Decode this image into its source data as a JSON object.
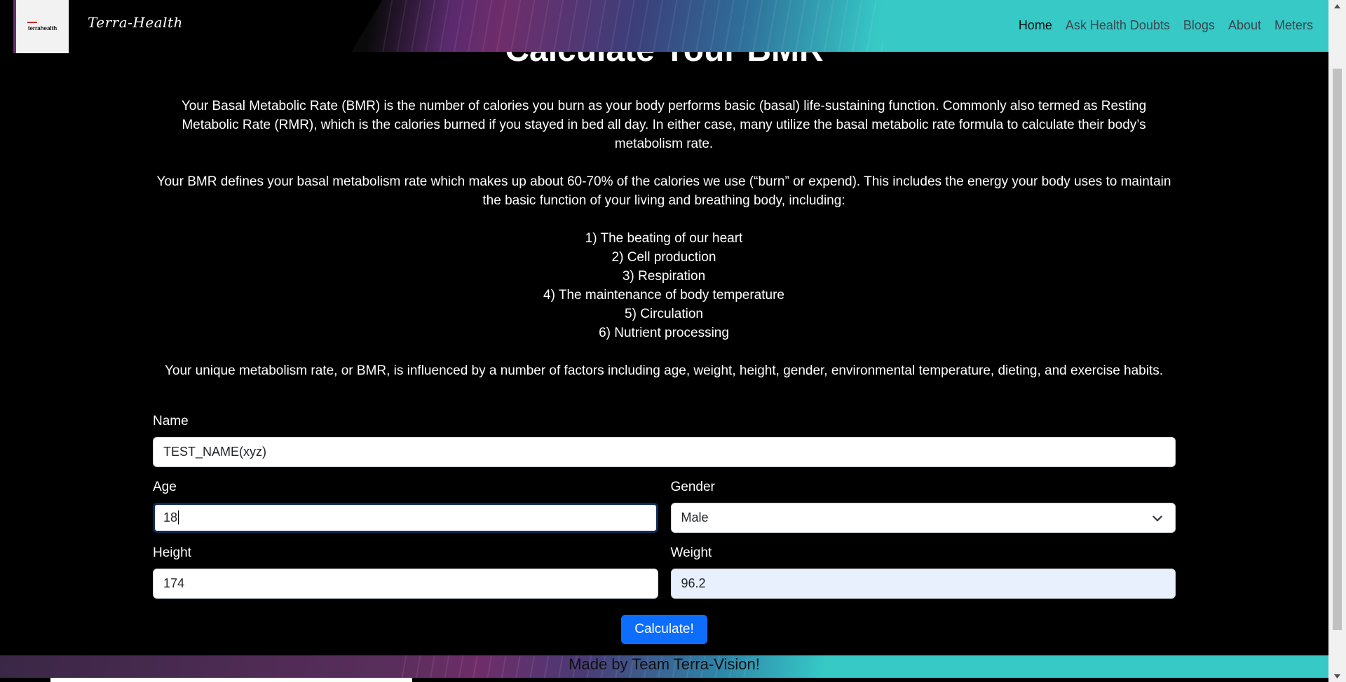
{
  "nav": {
    "logo_text": "terrahealth",
    "brand": "Terra-Health",
    "links": [
      "Home",
      "Ask Health Doubts",
      "Blogs",
      "About",
      "Meters"
    ],
    "active": "Home"
  },
  "main": {
    "title": "Calculate Your BMR",
    "para1": "Your Basal Metabolic Rate (BMR) is the number of calories you burn as your body performs basic (basal) life-sustaining function. Commonly also termed as Resting Metabolic Rate (RMR), which is the calories burned if you stayed in bed all day. In either case, many utilize the basal metabolic rate formula to calculate their body’s metabolism rate.",
    "para2": "Your BMR defines your basal metabolism rate which makes up about 60-70% of the calories we use (“burn” or expend). This includes the energy your body uses to maintain the basic function of your living and breathing body, including:",
    "list": [
      "1) The beating of our heart",
      "2) Cell production",
      "3) Respiration",
      "4) The maintenance of body temperature",
      "5) Circulation",
      "6) Nutrient processing"
    ],
    "para3": "Your unique metabolism rate, or BMR, is influenced by a number of factors including age, weight, height, gender, environmental temperature, dieting, and exercise habits."
  },
  "form": {
    "name_label": "Name",
    "name_value": "TEST_NAME(xyz)",
    "age_label": "Age",
    "age_value": "18",
    "gender_label": "Gender",
    "gender_value": "Male",
    "height_label": "Height",
    "height_value": "174",
    "weight_label": "Weight",
    "weight_value": "96.2",
    "submit_label": "Calculate!"
  },
  "footer": {
    "text": "Made by Team Terra-Vision!"
  },
  "colors": {
    "accent": "#0d6efd",
    "nav_teal": "#36c9c6",
    "nav_purple": "#6f2d6b"
  }
}
